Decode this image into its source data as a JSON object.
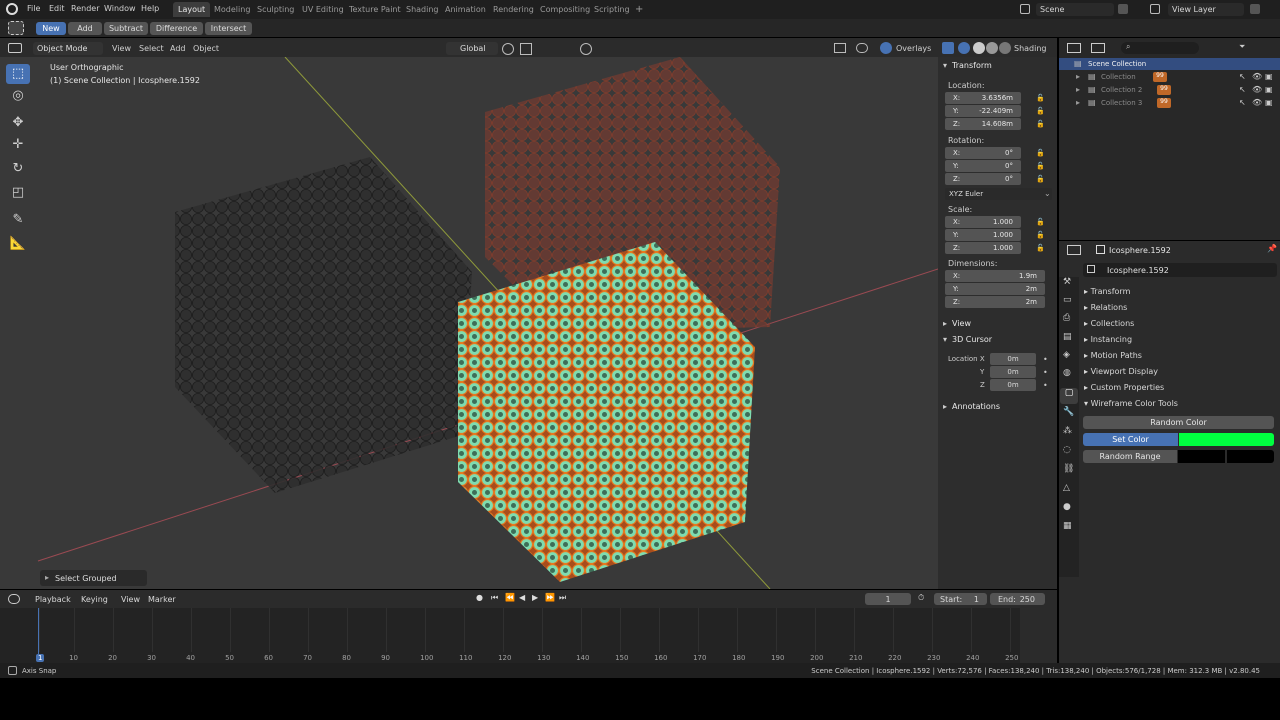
{
  "menus": [
    "File",
    "Edit",
    "Render",
    "Window",
    "Help"
  ],
  "workspaces": [
    "Layout",
    "Modeling",
    "Sculpting",
    "UV Editing",
    "Texture Paint",
    "Shading",
    "Animation",
    "Rendering",
    "Compositing",
    "Scripting"
  ],
  "add_workspace": "+",
  "scene": "Scene",
  "view_layer": "View Layer",
  "tool_buttons": [
    "New",
    "Add",
    "Subtract",
    "Difference",
    "Intersect"
  ],
  "viewport": {
    "mode": "Object Mode",
    "menus": [
      "View",
      "Select",
      "Add",
      "Object"
    ],
    "orientation": "Global",
    "overlays": "Overlays",
    "shading": "Shading",
    "view_name": "User Orthographic",
    "collection_info": "(1) Scene Collection | Icosphere.1592",
    "last_op": "Select Grouped"
  },
  "npanel": {
    "transform_title": "Transform",
    "location_label": "Location:",
    "location": [
      {
        "k": "X:",
        "v": "3.6356m"
      },
      {
        "k": "Y:",
        "v": "-22.409m"
      },
      {
        "k": "Z:",
        "v": "14.608m"
      }
    ],
    "rotation_label": "Rotation:",
    "rotation": [
      {
        "k": "X:",
        "v": "0°"
      },
      {
        "k": "Y:",
        "v": "0°"
      },
      {
        "k": "Z:",
        "v": "0°"
      }
    ],
    "rotation_mode": "XYZ Euler",
    "scale_label": "Scale:",
    "scale": [
      {
        "k": "X:",
        "v": "1.000"
      },
      {
        "k": "Y:",
        "v": "1.000"
      },
      {
        "k": "Z:",
        "v": "1.000"
      }
    ],
    "dimensions_label": "Dimensions:",
    "dimensions": [
      {
        "k": "X:",
        "v": "1.9m"
      },
      {
        "k": "Y:",
        "v": "2m"
      },
      {
        "k": "Z:",
        "v": "2m"
      }
    ],
    "view_title": "View",
    "cursor_title": "3D Cursor",
    "cursor": [
      {
        "k": "Location X",
        "v": "0m"
      },
      {
        "k": "Y",
        "v": "0m"
      },
      {
        "k": "Z",
        "v": "0m"
      }
    ],
    "annotations_title": "Annotations"
  },
  "outliner": {
    "root": "Scene Collection",
    "items": [
      "Collection",
      "Collection 2",
      "Collection 3"
    ],
    "badge": "99"
  },
  "properties": {
    "object_name": "Icosphere.1592",
    "sections": [
      "Transform",
      "Relations",
      "Collections",
      "Instancing",
      "Motion Paths",
      "Viewport Display",
      "Custom Properties",
      "Wireframe Color Tools"
    ],
    "random_color": "Random Color",
    "set_color": "Set Color",
    "set_color_value": "#00ff40",
    "random_range": "Random Range"
  },
  "timeline": {
    "menus": [
      "Playback",
      "Keying",
      "View",
      "Marker"
    ],
    "current_frame": "1",
    "start_label": "Start:",
    "start": "1",
    "end_label": "End:",
    "end": "250",
    "ticks": [
      "1",
      "10",
      "20",
      "30",
      "40",
      "50",
      "60",
      "70",
      "80",
      "90",
      "100",
      "110",
      "120",
      "130",
      "140",
      "150",
      "160",
      "170",
      "180",
      "190",
      "200",
      "210",
      "220",
      "230",
      "240",
      "250"
    ]
  },
  "status": {
    "left": "Axis Snap",
    "right": "Scene Collection | Icosphere.1592 | Verts:72,576 | Faces:138,240 | Tris:138,240 | Objects:576/1,728 | Mem: 312.3 MB | v2.80.45"
  }
}
